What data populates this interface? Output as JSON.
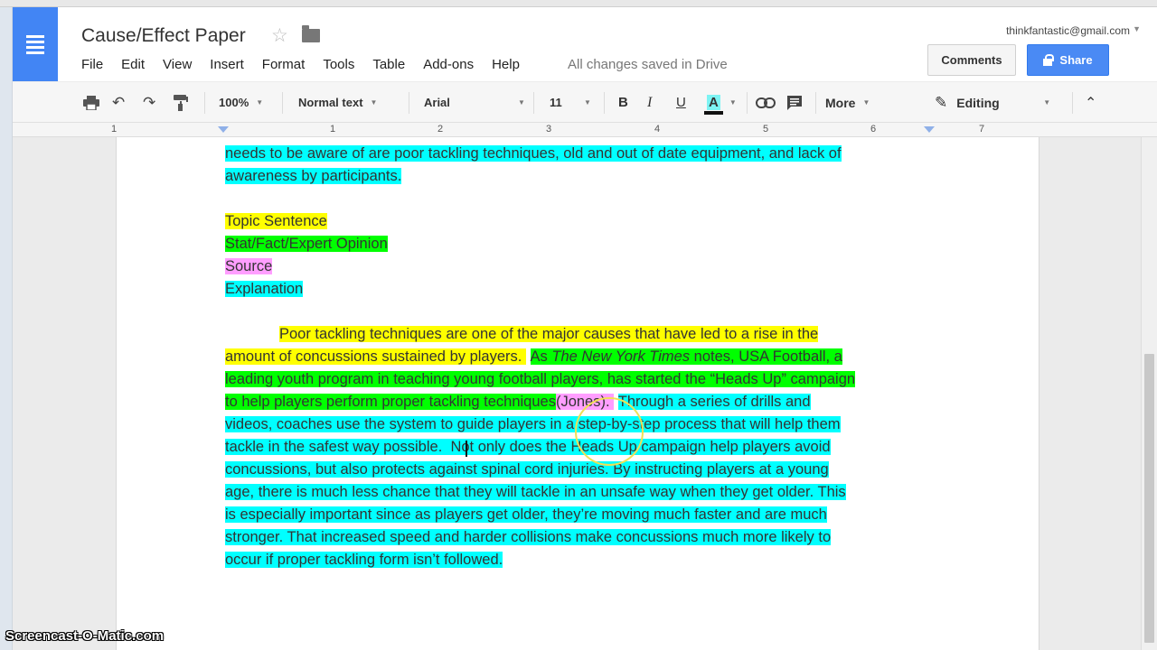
{
  "doc": {
    "title": "Cause/Effect Paper",
    "account_email": "thinkfantastic@gmail.com",
    "save_status": "All changes saved in Drive"
  },
  "menu": [
    "File",
    "Edit",
    "View",
    "Insert",
    "Format",
    "Tools",
    "Table",
    "Add-ons",
    "Help"
  ],
  "buttons": {
    "comments": "Comments",
    "share": "Share"
  },
  "toolbar": {
    "zoom": "100%",
    "style": "Normal text",
    "font": "Arial",
    "size": "11",
    "bold": "B",
    "italic": "I",
    "underline": "U",
    "text_color": "A",
    "more": "More",
    "mode": "Editing"
  },
  "ruler": [
    "1",
    "1",
    "2",
    "3",
    "4",
    "5",
    "6",
    "7"
  ],
  "document": {
    "p1_l1": "needs to be aware of are poor tackling techniques, old and out of date equipment, and lack of",
    "p1_l2": "awareness by participants.",
    "legend": {
      "topic": "Topic Sentence",
      "stat": "Stat/Fact/Expert Opinion",
      "source": "Source",
      "explanation": "Explanation"
    },
    "p2": {
      "l1": "Poor tackling techniques are one of the major causes that have led to a rise in the",
      "l2_y": "amount of concussions sustained by players.",
      "l2_g1": "As ",
      "l2_gi": "The New York Times",
      "l2_g2": " notes, USA Football, a",
      "l3": "leading youth program in teaching young football players, has started the “Heads Up” campaign",
      "l4_g": "to help players perform proper tackling techniques",
      "l4_p": "(Jones).",
      "l4_c": "Through a series of drills and",
      "l5": "videos, coaches use the system to guide players in a step-by-step process that will help them",
      "l6_a": "tackle in the safest way possible.",
      "l6_b": "Not only does the Heads Up campaign help players avoid",
      "l7": "concussions, but also protects against spinal cord injuries.  By instructing players at a young",
      "l8": "age, there is much less chance that they will tackle in an unsafe way when they get older.  This",
      "l9": "is especially important since as players get older, they’re moving much faster and are much",
      "l10": "stronger.  That increased speed and harder collisions make concussions much more likely to",
      "l11": "occur if proper tackling form isn’t followed."
    }
  },
  "watermark": "Screencast-O-Matic.com",
  "colors": {
    "topic": "#ffff00",
    "stat": "#00ff00",
    "source": "#ff9eff",
    "explanation": "#00ffff",
    "share_button": "#4a8af4",
    "docs_brand": "#4285f4"
  }
}
